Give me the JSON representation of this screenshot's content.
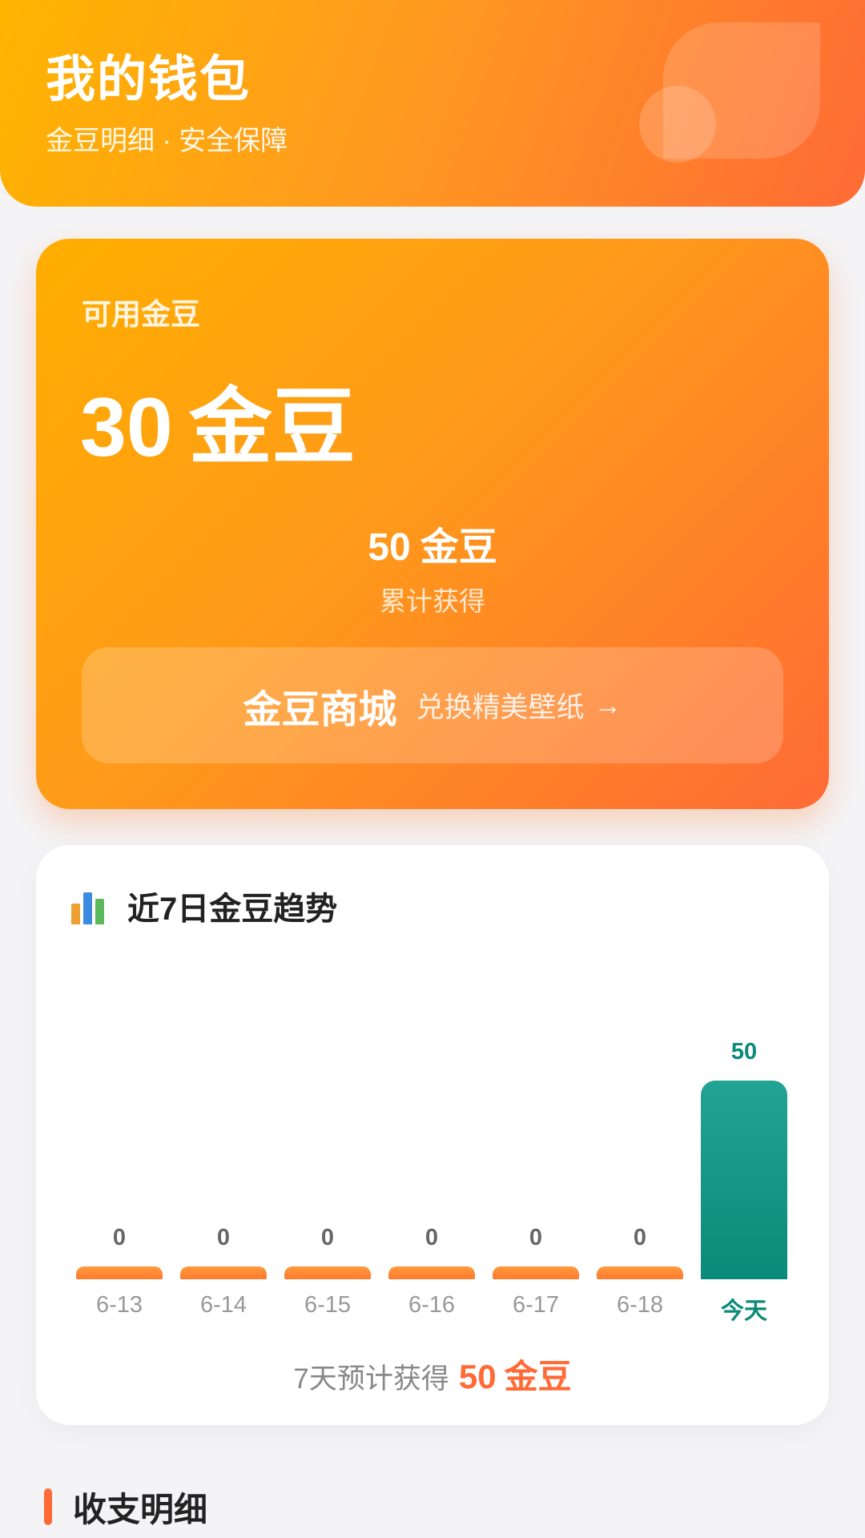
{
  "header": {
    "title": "我的钱包",
    "subtitle": "金豆明细 · 安全保障"
  },
  "balance": {
    "label": "可用金豆",
    "amount": "30",
    "unit": "金豆",
    "total_amount": "50",
    "total_unit": "金豆",
    "total_label": "累计获得",
    "mall_title": "金豆商城",
    "mall_subtitle": "兑换精美壁纸",
    "mall_arrow": "→"
  },
  "trend": {
    "icon": "bar-chart-icon",
    "title": "近7日金豆趋势",
    "summary_prefix": "7天预计获得",
    "summary_value": "50",
    "summary_unit": "金豆"
  },
  "chart_data": {
    "type": "bar",
    "categories": [
      "6-13",
      "6-14",
      "6-15",
      "6-16",
      "6-17",
      "6-18",
      "今天"
    ],
    "values": [
      0,
      0,
      0,
      0,
      0,
      0,
      50
    ],
    "title": "近7日金豆趋势",
    "xlabel": "",
    "ylabel": "",
    "grid": false,
    "highlight_category": "今天",
    "colors": {
      "normal": "#ff8a35",
      "highlight": "#0a8a78"
    }
  },
  "details": {
    "title": "收支明细"
  },
  "colors": {
    "primary": "#ff9a1a",
    "accent": "#ff6a35",
    "teal": "#0a8a78",
    "background": "#f4f4f6"
  }
}
